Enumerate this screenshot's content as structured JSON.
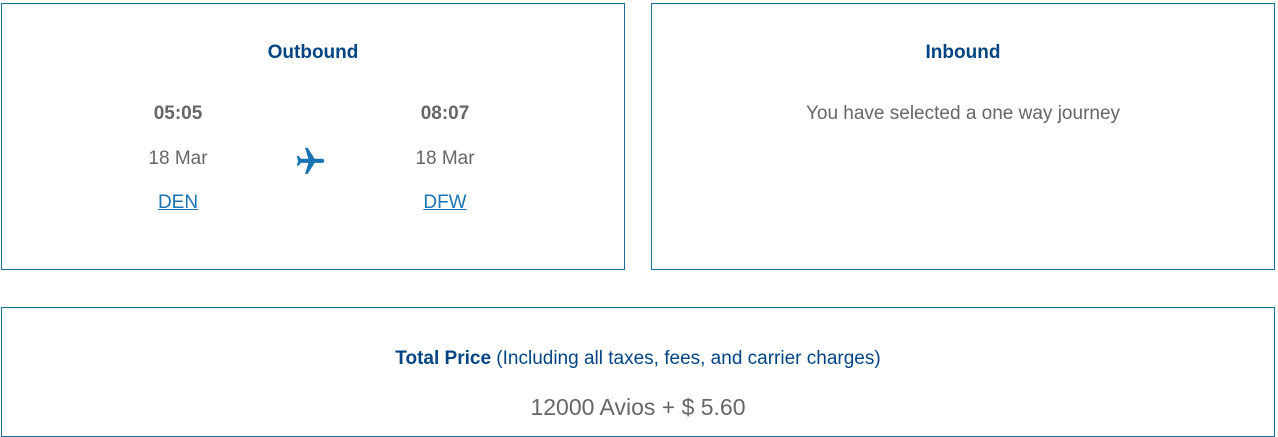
{
  "outbound": {
    "title": "Outbound",
    "departure": {
      "time": "05:05",
      "date": "18 Mar",
      "airport": "DEN"
    },
    "arrival": {
      "time": "08:07",
      "date": "18 Mar",
      "airport": "DFW"
    },
    "icon": "airplane-icon"
  },
  "inbound": {
    "title": "Inbound",
    "message": "You have selected a one way journey"
  },
  "price": {
    "label": "Total Price",
    "note": "(Including all taxes, fees, and carrier charges)",
    "value": "12000 Avios + $ 5.60"
  },
  "colors": {
    "border": "#1a6f99",
    "heading": "#024582",
    "link": "#1a75b5",
    "text": "#666666"
  }
}
